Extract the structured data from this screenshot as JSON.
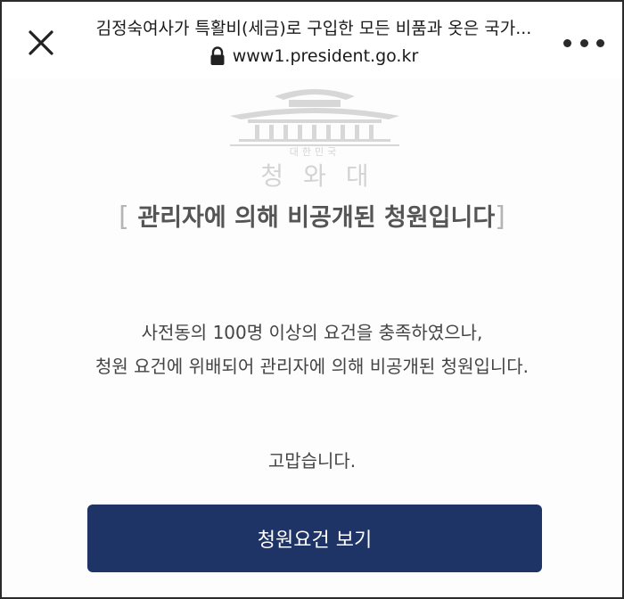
{
  "browser": {
    "page_title": "김정숙여사가 특활비(세금)로 구입한 모든 비품과 옷은 국가...",
    "url": "www1.president.go.kr"
  },
  "logo": {
    "subtitle": "대한민국",
    "name": "청와대"
  },
  "content": {
    "heading": "관리자에 의해 비공개된 청원입니다",
    "message_lines": [
      "사전동의 100명 이상의 요건을 충족하였으나,",
      "청원 요건에 위배되어 관리자에 의해 비공개된 청원입니다."
    ],
    "thanks": "고맙습니다.",
    "cta_label": "청원요건 보기"
  },
  "colors": {
    "cta_background": "#1f3466",
    "heading_text": "#555555",
    "bracket": "#b5b5b5"
  },
  "icons": [
    "close-icon",
    "lock-icon",
    "more-icon",
    "cheongwadae-logo"
  ]
}
